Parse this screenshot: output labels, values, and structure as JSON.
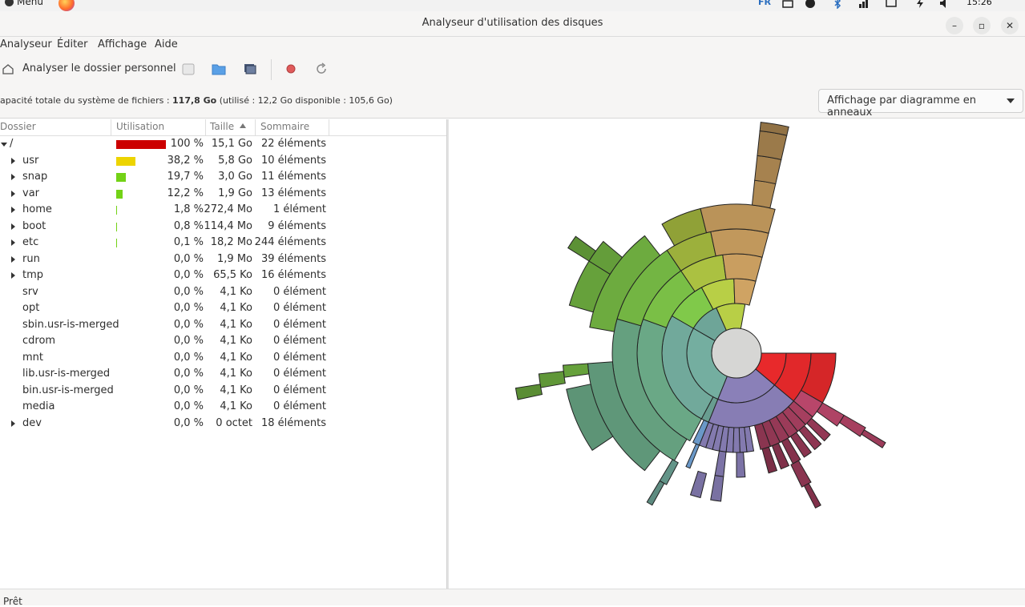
{
  "topbar": {
    "menu_label": "Menu",
    "layout_indicator": "FR",
    "clock": "15:26"
  },
  "window": {
    "title": "Analyseur d'utilisation des disques"
  },
  "menubar": {
    "items": [
      "Analyseur",
      "Éditer",
      "Affichage",
      "Aide"
    ]
  },
  "toolbar": {
    "scan_home_label": "Analyser le dossier personnel"
  },
  "infobar": {
    "capacity_prefix": "apacité totale du système de fichiers : ",
    "capacity_total": "117,8 Go",
    "capacity_detail": " (utilisé : 12,2 Go disponible : 105,6 Go)",
    "view_mode": "Affichage par diagramme en anneaux"
  },
  "columns": {
    "folder": "Dossier",
    "usage": "Utilisation",
    "size": "Taille",
    "summary": "Sommaire"
  },
  "rows": [
    {
      "name": "/",
      "usage": 100,
      "pct": "100 %",
      "size": "15,1 Go",
      "count": "22 éléments",
      "expander": "open",
      "bar_color": "#cc0000"
    },
    {
      "name": "usr",
      "usage": 38.2,
      "pct": "38,2 %",
      "size": "5,8 Go",
      "count": "10 éléments",
      "expander": "closed",
      "bar_color": "#edd400"
    },
    {
      "name": "snap",
      "usage": 19.7,
      "pct": "19,7 %",
      "size": "3,0 Go",
      "count": "11 éléments",
      "expander": "closed",
      "bar_color": "#73d216"
    },
    {
      "name": "var",
      "usage": 12.2,
      "pct": "12,2 %",
      "size": "1,9 Go",
      "count": "13 éléments",
      "expander": "closed",
      "bar_color": "#73d216"
    },
    {
      "name": "home",
      "usage": 1.8,
      "pct": "1,8 %",
      "size": "272,4 Mo",
      "count": "1 élément",
      "expander": "closed",
      "bar_color": "#73d216"
    },
    {
      "name": "boot",
      "usage": 0.8,
      "pct": "0,8 %",
      "size": "114,4 Mo",
      "count": "9 éléments",
      "expander": "closed",
      "bar_color": "#73d216"
    },
    {
      "name": "etc",
      "usage": 0.1,
      "pct": "0,1 %",
      "size": "18,2 Mo",
      "count": "244 éléments",
      "expander": "closed",
      "bar_color": "#73d216"
    },
    {
      "name": "run",
      "usage": 0,
      "pct": "0,0 %",
      "size": "1,9 Mo",
      "count": "39 éléments",
      "expander": "closed",
      "bar_color": "#73d216"
    },
    {
      "name": "tmp",
      "usage": 0,
      "pct": "0,0 %",
      "size": "65,5 Ko",
      "count": "16 éléments",
      "expander": "closed",
      "bar_color": "#73d216"
    },
    {
      "name": "srv",
      "usage": 0,
      "pct": "0,0 %",
      "size": "4,1 Ko",
      "count": "0 élément",
      "expander": "none",
      "bar_color": "#73d216"
    },
    {
      "name": "opt",
      "usage": 0,
      "pct": "0,0 %",
      "size": "4,1 Ko",
      "count": "0 élément",
      "expander": "none",
      "bar_color": "#73d216"
    },
    {
      "name": "sbin.usr-is-merged",
      "usage": 0,
      "pct": "0,0 %",
      "size": "4,1 Ko",
      "count": "0 élément",
      "expander": "none",
      "bar_color": "#73d216"
    },
    {
      "name": "cdrom",
      "usage": 0,
      "pct": "0,0 %",
      "size": "4,1 Ko",
      "count": "0 élément",
      "expander": "none",
      "bar_color": "#73d216"
    },
    {
      "name": "mnt",
      "usage": 0,
      "pct": "0,0 %",
      "size": "4,1 Ko",
      "count": "0 élément",
      "expander": "none",
      "bar_color": "#73d216"
    },
    {
      "name": "lib.usr-is-merged",
      "usage": 0,
      "pct": "0,0 %",
      "size": "4,1 Ko",
      "count": "0 élément",
      "expander": "none",
      "bar_color": "#73d216"
    },
    {
      "name": "bin.usr-is-merged",
      "usage": 0,
      "pct": "0,0 %",
      "size": "4,1 Ko",
      "count": "0 élément",
      "expander": "none",
      "bar_color": "#73d216"
    },
    {
      "name": "media",
      "usage": 0,
      "pct": "0,0 %",
      "size": "4,1 Ko",
      "count": "0 élément",
      "expander": "none",
      "bar_color": "#73d216"
    },
    {
      "name": "dev",
      "usage": 0,
      "pct": "0,0 %",
      "size": "0 octet",
      "count": "18 éléments",
      "expander": "closed",
      "bar_color": "#73d216"
    }
  ],
  "ring_chart": {
    "center_color": "#d6d6d4",
    "segments": [
      {
        "color": "#e8292b"
      },
      {
        "color": "#8a80b8"
      },
      {
        "color": "#74aea0"
      },
      {
        "color": "#6aa886"
      },
      {
        "color": "#80c94a"
      },
      {
        "color": "#b8cf46"
      },
      {
        "color": "#cfa363"
      },
      {
        "color": "#b8466a"
      }
    ]
  },
  "statusbar": {
    "text": "Prêt"
  }
}
